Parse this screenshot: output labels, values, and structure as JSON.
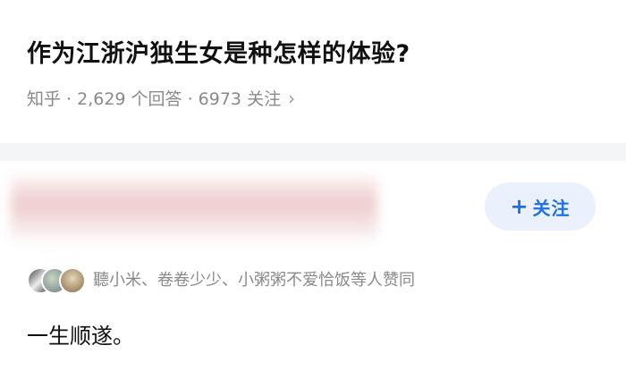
{
  "question": {
    "title": "作为江浙沪独生女是种怎样的体验?",
    "meta": "知乎 · 2,629 个回答 · 6973 关注",
    "meta_chevron": "›"
  },
  "answer_header": {
    "follow_plus": "+",
    "follow_label": "关注"
  },
  "upvoters": {
    "text": "聽小米、卷卷少少、小粥粥不爱恰饭等人赞同"
  },
  "answer": {
    "content": "一生顺遂。"
  },
  "colors": {
    "accent_blue": "#1f6fe5",
    "follow_bg": "#eaf1fd",
    "meta_gray": "#8a8a8a"
  }
}
